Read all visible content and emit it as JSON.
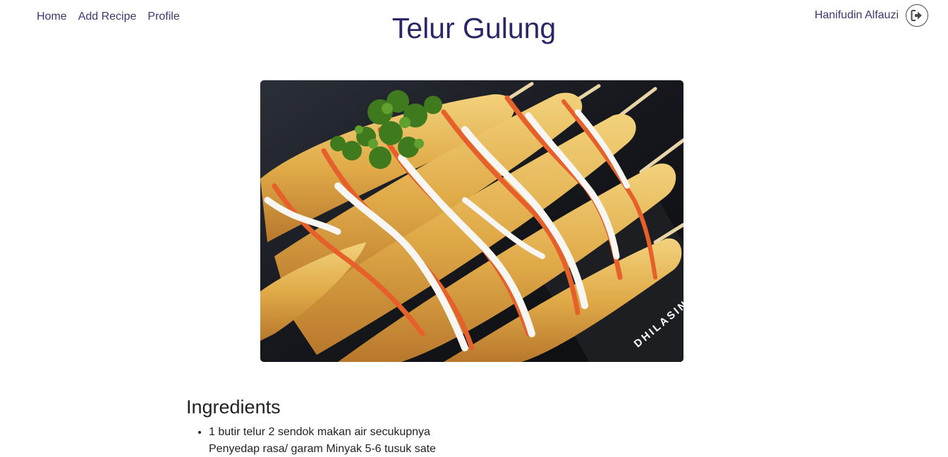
{
  "nav": {
    "links": [
      "Home",
      "Add Recipe",
      "Profile"
    ]
  },
  "user": {
    "name": "Hanifudin Alfauzi",
    "logout_icon": "sign-out-icon"
  },
  "recipe": {
    "title": "Telur Gulung",
    "photo_watermark": "DHILASIN",
    "ingredients_heading": "Ingredients",
    "ingredients": [
      {
        "line1": "1 butir telur 2 sendok makan air secukupnya",
        "line2": "Penyedap rasa/ garam Minyak 5-6 tusuk sate"
      }
    ]
  },
  "colors": {
    "nav_text": "#3b3773",
    "title": "#2a2766",
    "body_text": "#222222"
  }
}
